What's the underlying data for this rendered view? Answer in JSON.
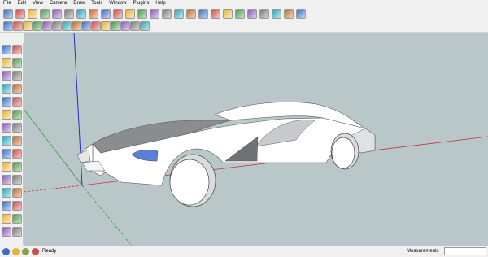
{
  "menu": [
    "File",
    "Edit",
    "View",
    "Camera",
    "Draw",
    "Tools",
    "Window",
    "Plugins",
    "Help"
  ],
  "toolbar_icons_row1": [
    "select-icon",
    "eraser-icon",
    "rectangle-icon",
    "line-icon",
    "circle-icon",
    "arc-icon",
    "polygon-icon",
    "freehand-icon",
    "pushpull-icon",
    "move-icon",
    "rotate-icon",
    "followme-icon",
    "scale-icon",
    "offset-icon",
    "orbit-icon",
    "pan-icon",
    "zoom-icon",
    "zoom-window-icon",
    "zoom-extents-icon",
    "previous-icon",
    "warehouse-icon",
    "share-model-icon",
    "components-icon",
    "styles-icon",
    "layers-icon"
  ],
  "toolbar_icons_row2": [
    "standard-view-iso",
    "view-top-icon",
    "view-front-icon",
    "view-right-icon",
    "view-back-icon",
    "view-left-icon",
    "xray-icon",
    "wireframe-icon",
    "shaded-icon",
    "textured-icon",
    "monochrome-icon",
    "shadows-icon",
    "fog-icon",
    "sun-icon",
    "section-icon"
  ],
  "left_toolbar_icons": [
    "select-icon",
    "make-component-icon",
    "paint-icon",
    "eraser-icon",
    "rectangle-icon",
    "circle-icon",
    "line-icon",
    "arc-icon",
    "pushpull-icon",
    "followme-icon",
    "move-icon",
    "rotate-icon",
    "scale-icon",
    "offset-icon",
    "tape-icon",
    "dimension-icon",
    "protractor-icon",
    "text-icon",
    "axes-icon",
    "3dtext-icon",
    "orbit-icon",
    "pan-icon",
    "zoom-icon",
    "zoom-window-icon",
    "zoom-extents-icon",
    "previous-icon",
    "position-camera-icon",
    "lookaround-icon",
    "walk-icon",
    "section-plane-icon"
  ],
  "colors": {
    "viewport_bg": "#b9c7c9",
    "axis_red": "#c0393b",
    "axis_green": "#2e9d3a",
    "axis_blue": "#2330c9",
    "car_body": "#ffffff",
    "car_shade": "#8a8d90",
    "window_blue": "#5b7fd6"
  },
  "status": {
    "text": "Ready",
    "measurements_label": "Measurements",
    "measurements_value": ""
  }
}
